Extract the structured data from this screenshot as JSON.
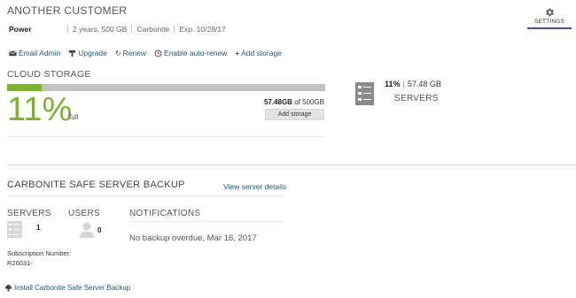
{
  "customer": {
    "name": "ANOTHER CUSTOMER"
  },
  "plan": {
    "name": "Power",
    "term": "2 years, 500 GB",
    "brand": "Carbonite",
    "expiry": "Exp. 10/28/17"
  },
  "settings": {
    "label": "SETTINGS",
    "icon": "gear-icon"
  },
  "actions": [
    {
      "label": "Email Admin",
      "icon": "envelope-icon"
    },
    {
      "label": "Upgrade",
      "icon": "upgrade-icon"
    },
    {
      "label": "Renew",
      "icon": "refresh-icon"
    },
    {
      "label": "Enable auto-renew",
      "icon": "history-icon"
    },
    {
      "label": "Add storage",
      "icon": "plus-icon"
    }
  ],
  "cloud_storage": {
    "label": "CLOUD STORAGE",
    "percent_text": "11%",
    "percent_value": 0.11,
    "full_label": "full",
    "used": "57.48GB",
    "of_text": " of 500GB",
    "add_button": "Add storage",
    "colors": {
      "fill": "#7bb32e",
      "track": "#c2c2c2"
    }
  },
  "servers_summary": {
    "pct": "11%",
    "sep": "|",
    "size": "57.48 GB",
    "label": "SERVERS",
    "icon": "server-icon"
  },
  "backup": {
    "title": "CARBONITE SAFE SERVER BACKUP",
    "view_details": "View server details",
    "servers_label": "SERVERS",
    "servers_count": "1",
    "users_label": "USERS",
    "users_count": "0",
    "notifications_label": "NOTIFICATIONS",
    "notification_text": "No backup overdue, Mar 16, 2017",
    "subscription_label": "Subscription Number:",
    "subscription_value": "R26031-"
  },
  "install": {
    "label": "Install Carbonite Safe Server Backup",
    "icon": "download-cloud-icon"
  },
  "colors": {
    "accent_green": "#7bb32e",
    "link_blue": "#1d5a7a",
    "settings_underline": "#5b4b8a"
  }
}
